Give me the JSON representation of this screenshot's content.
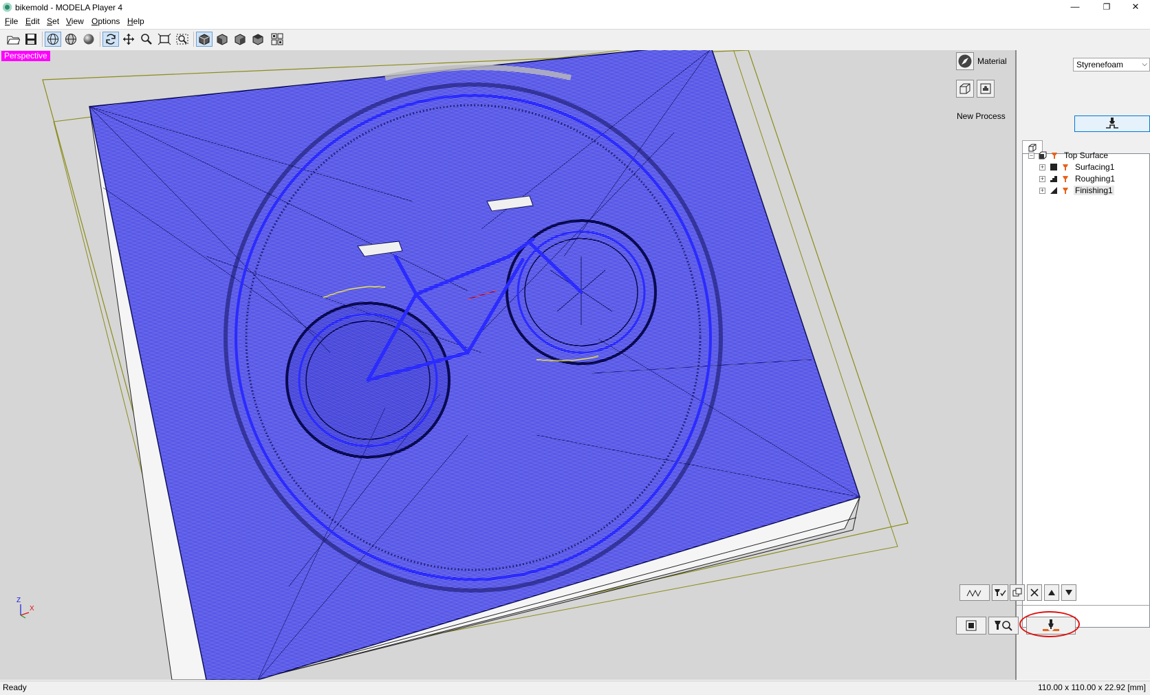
{
  "window": {
    "title": "bikemold - MODELA Player 4",
    "minimize": "—",
    "restore": "❐",
    "close": "✕"
  },
  "menu": {
    "file": {
      "underline": "F",
      "rest": "ile"
    },
    "edit": {
      "underline": "E",
      "rest": "dit"
    },
    "set": {
      "underline": "S",
      "rest": "et"
    },
    "view": {
      "underline": "V",
      "rest": "iew"
    },
    "options": {
      "underline": "O",
      "rest": "ptions"
    },
    "help": {
      "underline": "H",
      "rest": "elp"
    }
  },
  "toolbar_icons": [
    "open-icon",
    "save-icon",
    "wireframe-view-icon",
    "wireframe-solid-icon",
    "solid-shaded-icon",
    "rotate-icon",
    "pan-icon",
    "zoom-icon",
    "fit-view-icon",
    "zoom-window-icon",
    "iso-view-icon",
    "front-view-icon",
    "side-view-icon",
    "top-view-icon",
    "four-view-icon"
  ],
  "viewport": {
    "label": "Perspective",
    "axis_z": "Z",
    "axis_x": "X",
    "toolpath_color": "#1a1adf",
    "background": "#d6d6d6"
  },
  "panel": {
    "material_label": "Material",
    "material_value": "Styrenefoam",
    "new_process_label": "New Process"
  },
  "tree": {
    "root": "Top Surface",
    "items": [
      {
        "label": "Surfacing1"
      },
      {
        "label": "Roughing1"
      },
      {
        "label": "Finishing1"
      }
    ]
  },
  "status": {
    "left": "Ready",
    "right": "110.00 x 110.00 x 22.92 [mm]"
  },
  "colors": {
    "highlight_circle": "#e01010",
    "perspective_badge": "#ff00ff",
    "process_orange": "#e8621a"
  }
}
